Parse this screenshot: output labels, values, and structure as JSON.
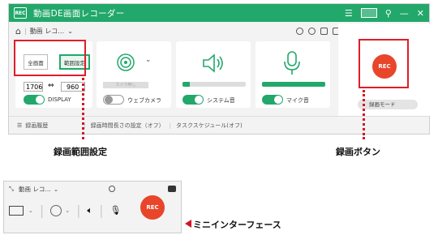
{
  "app": {
    "title": "動画DE画面レコーダー",
    "logo_text": "REC"
  },
  "toolbar": {
    "mode_label": "動画 レコ…",
    "chevron": "⌄"
  },
  "area": {
    "fullscreen_label": "全画面",
    "range_label": "範囲設定",
    "width": "1706",
    "height": "960",
    "display_label": "DISPLAY"
  },
  "camera": {
    "device_placeholder": "カメラ無し",
    "label": "ウェブカメラ",
    "enabled": false
  },
  "system_audio": {
    "label": "システム音",
    "enabled": true,
    "level": 0.12
  },
  "mic": {
    "label": "マイク音",
    "enabled": true,
    "level": 1.0
  },
  "record": {
    "button_label": "REC",
    "mode_label": "録画モード"
  },
  "statusbar": {
    "history": "録画履歴",
    "duration": "録画時間長さの設定（オフ）",
    "schedule": "タスクスケジュール(オフ)"
  },
  "callouts": {
    "range": "録画範囲設定",
    "record_button": "録画ボタン",
    "mini": "ミニインターフェース"
  },
  "mini": {
    "mode_label": "動画 レコ…",
    "chevron": "⌄",
    "rec_label": "REC"
  },
  "colors": {
    "accent": "#22a86a",
    "highlight": "#e11c2a",
    "rec": "#e8452a"
  }
}
